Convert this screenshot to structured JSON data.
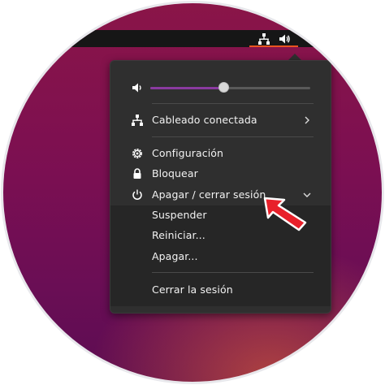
{
  "colors": {
    "accent_orange": "#e95420",
    "slider_purple": "#8a3aa0",
    "menu_bg": "#2f2f2f",
    "submenu_bg": "#262626",
    "arrow_red": "#e8202a"
  },
  "tray": {
    "icons": [
      "network-wired-icon",
      "volume-icon"
    ]
  },
  "menu": {
    "volume": {
      "icon": "volume-icon",
      "level": 0.46
    },
    "network": {
      "label": "Cableado conectada",
      "icon": "network-wired-icon",
      "chevron": "chevron-right-icon"
    },
    "settings": {
      "label": "Configuración",
      "icon": "gear-icon"
    },
    "lock": {
      "label": "Bloquear",
      "icon": "lock-icon"
    },
    "power": {
      "label": "Apagar / cerrar sesión",
      "icon": "power-icon",
      "chevron": "chevron-down-icon"
    },
    "power_submenu": {
      "suspend": "Suspender",
      "restart": "Reiniciar...",
      "shutdown": "Apagar...",
      "logout": "Cerrar la sesión"
    }
  },
  "annotation": {
    "icon": "red-arrow-pointer-icon"
  }
}
